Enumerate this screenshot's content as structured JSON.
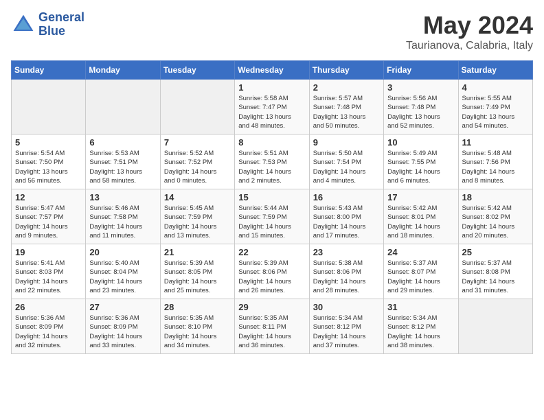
{
  "header": {
    "logo_line1": "General",
    "logo_line2": "Blue",
    "month_year": "May 2024",
    "location": "Taurianova, Calabria, Italy"
  },
  "weekdays": [
    "Sunday",
    "Monday",
    "Tuesday",
    "Wednesday",
    "Thursday",
    "Friday",
    "Saturday"
  ],
  "rows": [
    [
      {
        "day": "",
        "info": ""
      },
      {
        "day": "",
        "info": ""
      },
      {
        "day": "",
        "info": ""
      },
      {
        "day": "1",
        "info": "Sunrise: 5:58 AM\nSunset: 7:47 PM\nDaylight: 13 hours\nand 48 minutes."
      },
      {
        "day": "2",
        "info": "Sunrise: 5:57 AM\nSunset: 7:48 PM\nDaylight: 13 hours\nand 50 minutes."
      },
      {
        "day": "3",
        "info": "Sunrise: 5:56 AM\nSunset: 7:48 PM\nDaylight: 13 hours\nand 52 minutes."
      },
      {
        "day": "4",
        "info": "Sunrise: 5:55 AM\nSunset: 7:49 PM\nDaylight: 13 hours\nand 54 minutes."
      }
    ],
    [
      {
        "day": "5",
        "info": "Sunrise: 5:54 AM\nSunset: 7:50 PM\nDaylight: 13 hours\nand 56 minutes."
      },
      {
        "day": "6",
        "info": "Sunrise: 5:53 AM\nSunset: 7:51 PM\nDaylight: 13 hours\nand 58 minutes."
      },
      {
        "day": "7",
        "info": "Sunrise: 5:52 AM\nSunset: 7:52 PM\nDaylight: 14 hours\nand 0 minutes."
      },
      {
        "day": "8",
        "info": "Sunrise: 5:51 AM\nSunset: 7:53 PM\nDaylight: 14 hours\nand 2 minutes."
      },
      {
        "day": "9",
        "info": "Sunrise: 5:50 AM\nSunset: 7:54 PM\nDaylight: 14 hours\nand 4 minutes."
      },
      {
        "day": "10",
        "info": "Sunrise: 5:49 AM\nSunset: 7:55 PM\nDaylight: 14 hours\nand 6 minutes."
      },
      {
        "day": "11",
        "info": "Sunrise: 5:48 AM\nSunset: 7:56 PM\nDaylight: 14 hours\nand 8 minutes."
      }
    ],
    [
      {
        "day": "12",
        "info": "Sunrise: 5:47 AM\nSunset: 7:57 PM\nDaylight: 14 hours\nand 9 minutes."
      },
      {
        "day": "13",
        "info": "Sunrise: 5:46 AM\nSunset: 7:58 PM\nDaylight: 14 hours\nand 11 minutes."
      },
      {
        "day": "14",
        "info": "Sunrise: 5:45 AM\nSunset: 7:59 PM\nDaylight: 14 hours\nand 13 minutes."
      },
      {
        "day": "15",
        "info": "Sunrise: 5:44 AM\nSunset: 7:59 PM\nDaylight: 14 hours\nand 15 minutes."
      },
      {
        "day": "16",
        "info": "Sunrise: 5:43 AM\nSunset: 8:00 PM\nDaylight: 14 hours\nand 17 minutes."
      },
      {
        "day": "17",
        "info": "Sunrise: 5:42 AM\nSunset: 8:01 PM\nDaylight: 14 hours\nand 18 minutes."
      },
      {
        "day": "18",
        "info": "Sunrise: 5:42 AM\nSunset: 8:02 PM\nDaylight: 14 hours\nand 20 minutes."
      }
    ],
    [
      {
        "day": "19",
        "info": "Sunrise: 5:41 AM\nSunset: 8:03 PM\nDaylight: 14 hours\nand 22 minutes."
      },
      {
        "day": "20",
        "info": "Sunrise: 5:40 AM\nSunset: 8:04 PM\nDaylight: 14 hours\nand 23 minutes."
      },
      {
        "day": "21",
        "info": "Sunrise: 5:39 AM\nSunset: 8:05 PM\nDaylight: 14 hours\nand 25 minutes."
      },
      {
        "day": "22",
        "info": "Sunrise: 5:39 AM\nSunset: 8:06 PM\nDaylight: 14 hours\nand 26 minutes."
      },
      {
        "day": "23",
        "info": "Sunrise: 5:38 AM\nSunset: 8:06 PM\nDaylight: 14 hours\nand 28 minutes."
      },
      {
        "day": "24",
        "info": "Sunrise: 5:37 AM\nSunset: 8:07 PM\nDaylight: 14 hours\nand 29 minutes."
      },
      {
        "day": "25",
        "info": "Sunrise: 5:37 AM\nSunset: 8:08 PM\nDaylight: 14 hours\nand 31 minutes."
      }
    ],
    [
      {
        "day": "26",
        "info": "Sunrise: 5:36 AM\nSunset: 8:09 PM\nDaylight: 14 hours\nand 32 minutes."
      },
      {
        "day": "27",
        "info": "Sunrise: 5:36 AM\nSunset: 8:09 PM\nDaylight: 14 hours\nand 33 minutes."
      },
      {
        "day": "28",
        "info": "Sunrise: 5:35 AM\nSunset: 8:10 PM\nDaylight: 14 hours\nand 34 minutes."
      },
      {
        "day": "29",
        "info": "Sunrise: 5:35 AM\nSunset: 8:11 PM\nDaylight: 14 hours\nand 36 minutes."
      },
      {
        "day": "30",
        "info": "Sunrise: 5:34 AM\nSunset: 8:12 PM\nDaylight: 14 hours\nand 37 minutes."
      },
      {
        "day": "31",
        "info": "Sunrise: 5:34 AM\nSunset: 8:12 PM\nDaylight: 14 hours\nand 38 minutes."
      },
      {
        "day": "",
        "info": ""
      }
    ]
  ]
}
